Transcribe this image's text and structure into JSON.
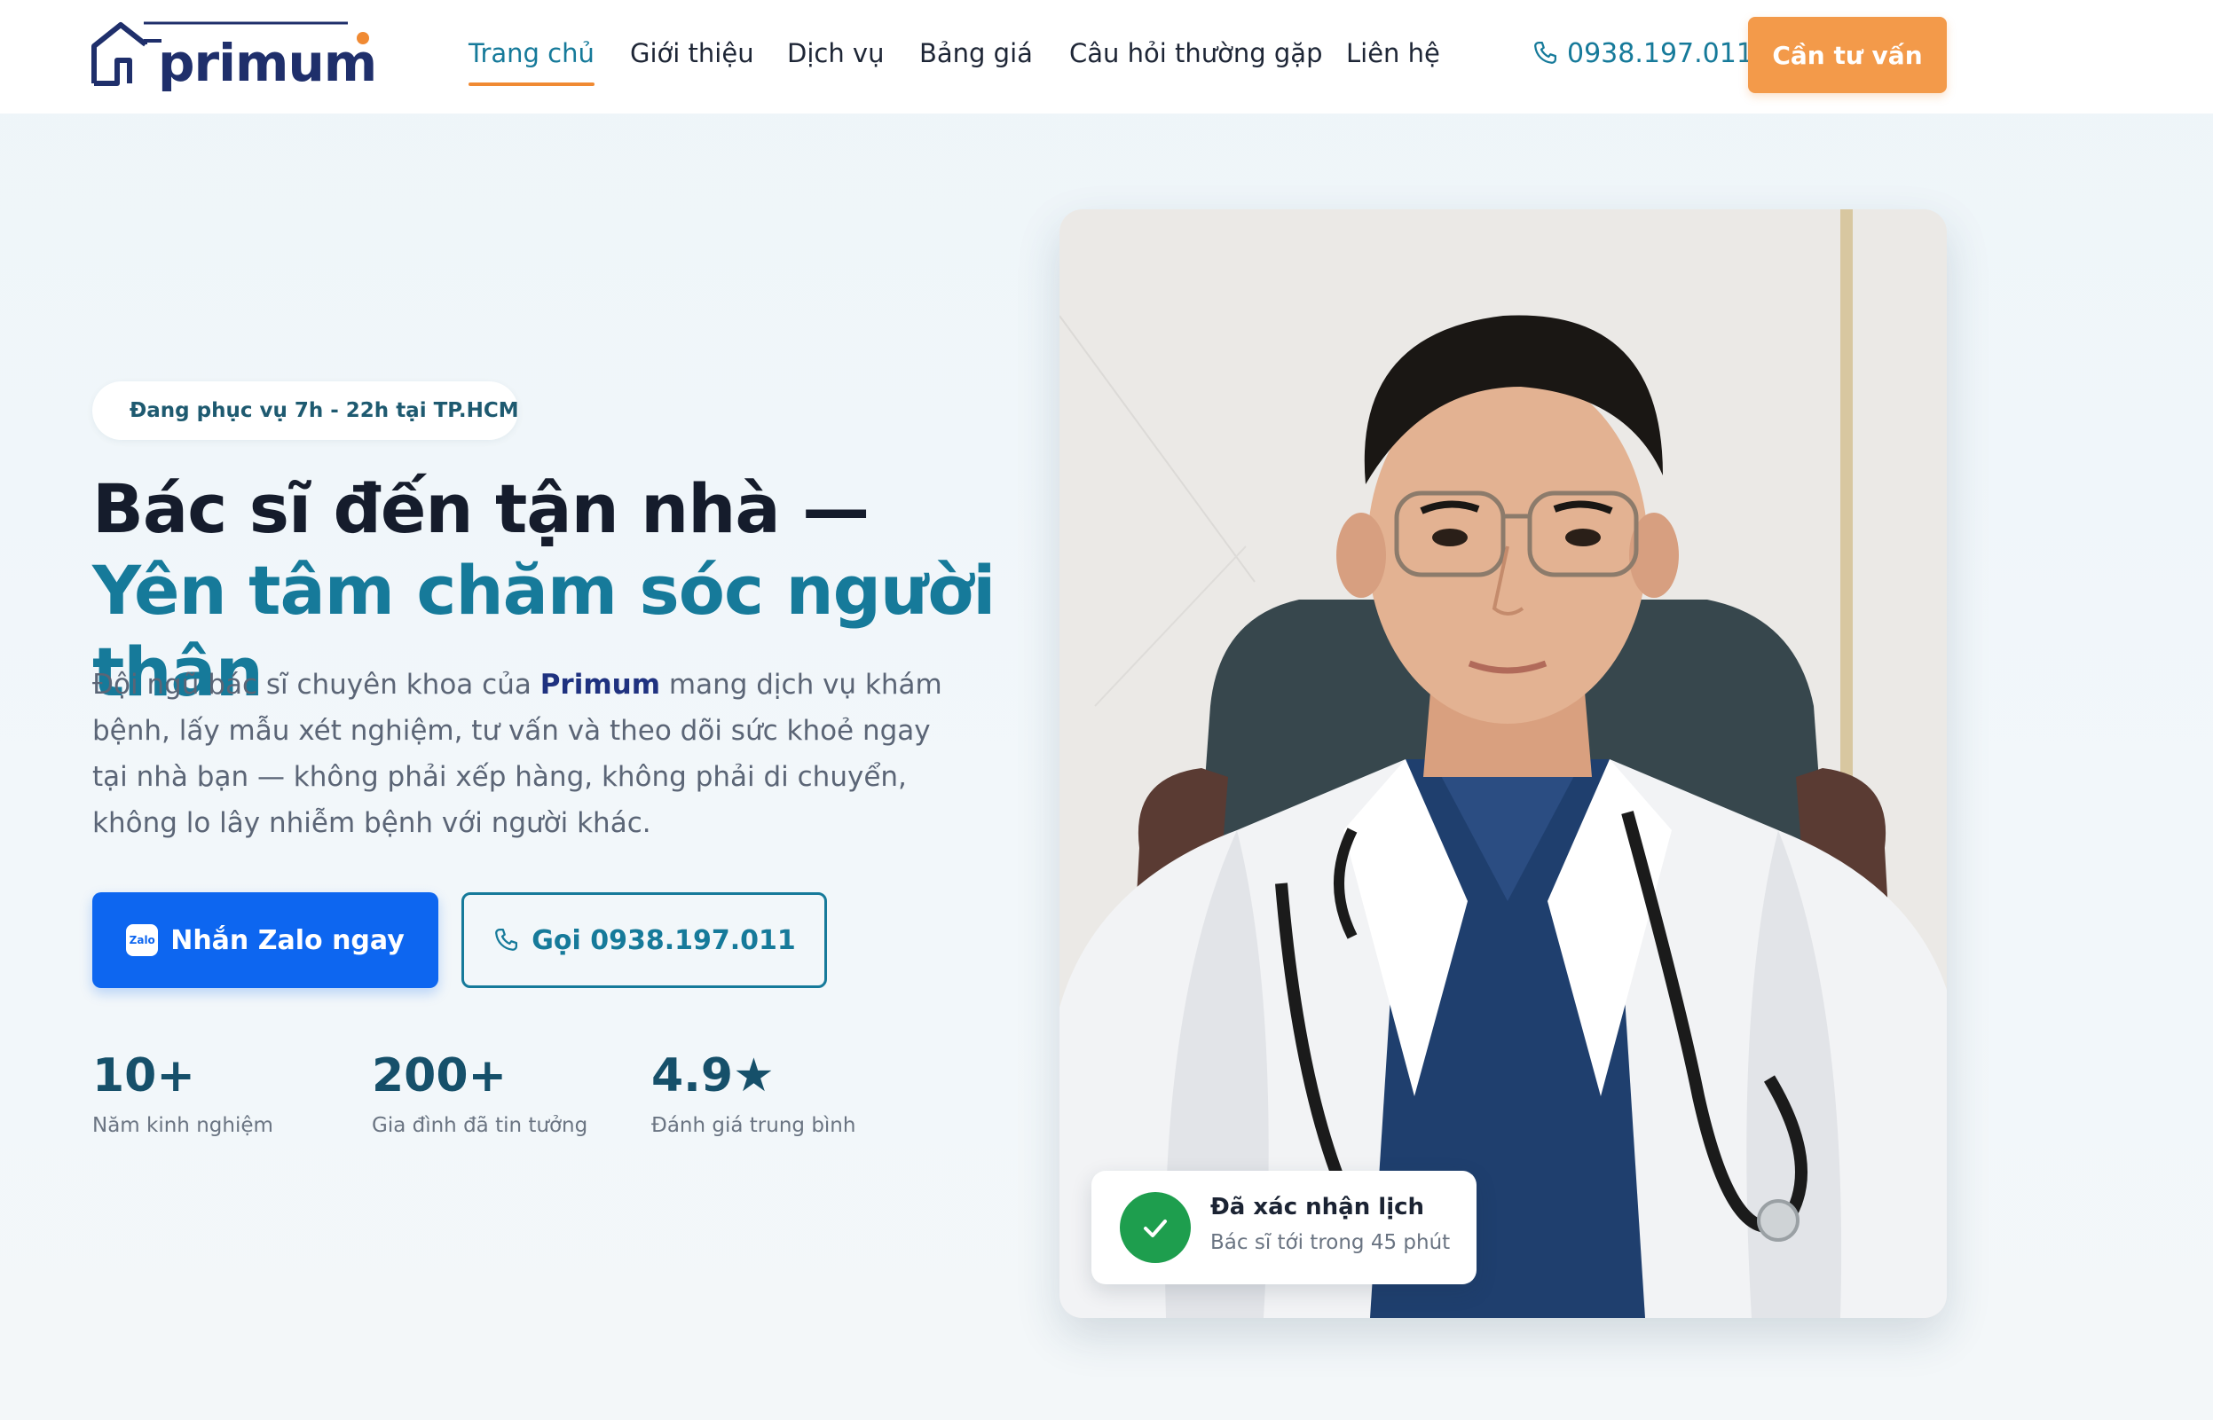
{
  "brand": {
    "name": "primum"
  },
  "nav": {
    "items": [
      {
        "label": "Trang chủ",
        "active": true
      },
      {
        "label": "Giới thiệu"
      },
      {
        "label": "Dịch vụ"
      },
      {
        "label": "Bảng giá"
      },
      {
        "label": "Câu hỏi thường gặp"
      },
      {
        "label": "Liên hệ"
      }
    ]
  },
  "header": {
    "phone": "0938.197.011",
    "cta_label": "Cần tư vấn"
  },
  "hero": {
    "badge": "Đang phục vụ 7h - 22h tại TP.HCM",
    "headline_part1": "Bác sĩ đến tận nhà — ",
    "headline_part2": "Yên tâm chăm sóc người thân",
    "desc_before": "Đội ngũ bác sĩ chuyên khoa của ",
    "desc_brand": "Primum",
    "desc_after": " mang dịch vụ khám bệnh, lấy mẫu xét nghiệm, tư vấn và theo dõi sức khoẻ ngay tại nhà bạn — không phải xếp hàng, không phải di chuyển, không lo lây nhiễm bệnh với người khác.",
    "zalo_label": "Nhắn Zalo ngay",
    "zalo_icon_text": "Zalo",
    "call_label": "Gọi 0938.197.011"
  },
  "stats": [
    {
      "value": "10+",
      "label": "Năm kinh nghiệm"
    },
    {
      "value": "200+",
      "label": "Gia đình đã tin tưởng"
    },
    {
      "value": "4.9★",
      "label": "Đánh giá trung bình"
    }
  ],
  "confirmation": {
    "title": "Đã xác nhận lịch",
    "subtitle": "Bác sĩ tới trong 45 phút"
  },
  "colors": {
    "primary_teal": "#167a9a",
    "accent_orange": "#f39a4a",
    "zalo_blue": "#0d66f0",
    "navy": "#1f2f6b",
    "success_green": "#1e9e4e"
  }
}
